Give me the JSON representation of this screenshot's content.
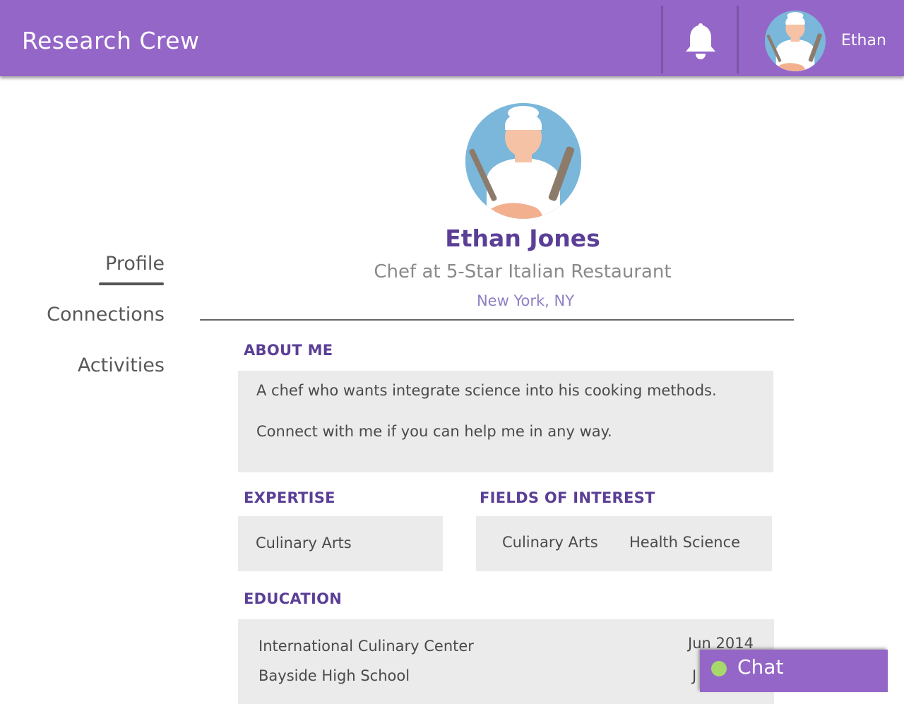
{
  "header": {
    "brand": "Research Crew",
    "notifications_icon": "bell-icon",
    "user": {
      "name": "Ethan",
      "avatar": "chef-avatar"
    }
  },
  "sidebar": {
    "items": [
      {
        "label": "Profile",
        "active": true
      },
      {
        "label": "Connections",
        "active": false
      },
      {
        "label": "Activities",
        "active": false
      }
    ]
  },
  "profile": {
    "name": "Ethan Jones",
    "title": "Chef at 5-Star Italian Restaurant",
    "location": "New York, NY",
    "avatar": "chef-avatar"
  },
  "about": {
    "heading": "ABOUT ME",
    "paragraphs": [
      "A chef who wants integrate science into his cooking methods.",
      "Connect with me if you can help me in any way."
    ]
  },
  "expertise": {
    "heading": "EXPERTISE",
    "items": [
      "Culinary Arts"
    ]
  },
  "interests": {
    "heading": "FIELDS OF INTEREST",
    "items": [
      "Culinary Arts",
      "Health Science"
    ]
  },
  "education": {
    "heading": "EDUCATION",
    "entries": [
      {
        "school": "International Culinary Center",
        "date": "Jun 2014"
      },
      {
        "school": "Bayside High School",
        "date": "J"
      }
    ]
  },
  "chat": {
    "label": "Chat",
    "status_color": "#a6d96a"
  },
  "colors": {
    "header": "#9466c8",
    "accent": "#5b3f96",
    "panel": "#ebebeb"
  }
}
